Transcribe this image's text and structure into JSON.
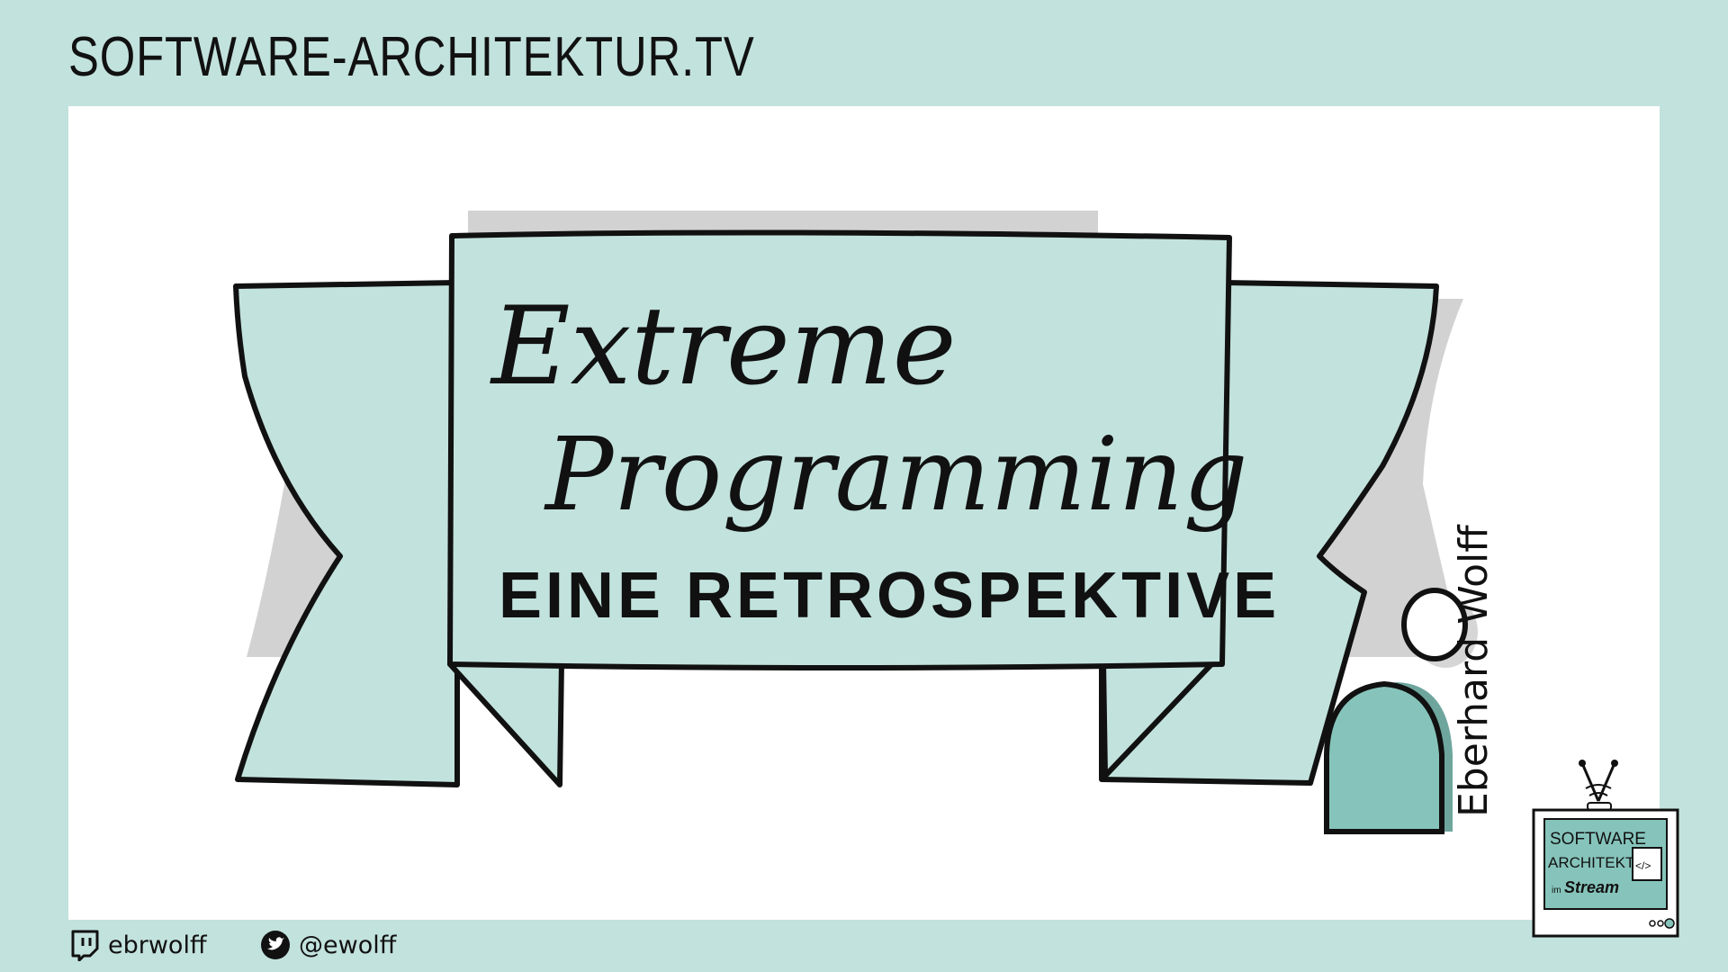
{
  "header": {
    "site_title": "SOFTWARE-ARCHITEKTUR.TV"
  },
  "slide": {
    "title_line1": "Extreme",
    "title_line2": "Programming",
    "subtitle": "EINE RETROSPEKTIVE",
    "presenter": "Eberhard Wolff"
  },
  "footer": {
    "twitch_handle": "ebrwolff",
    "twitter_handle": "@ewolff"
  },
  "logo": {
    "line1": "SOFTWARE",
    "line2": "ARCHITEKTUR",
    "line3_prefix": "im",
    "line3": "Stream",
    "code_glyph": "</>"
  },
  "colors": {
    "background": "#c2e2dd",
    "banner_fill": "#c2e2dd",
    "person_fill": "#86c4bb",
    "outline": "#111111"
  },
  "icons": {
    "twitch": "twitch-icon",
    "twitter": "twitter-bird-icon",
    "logo": "tv-logo"
  }
}
